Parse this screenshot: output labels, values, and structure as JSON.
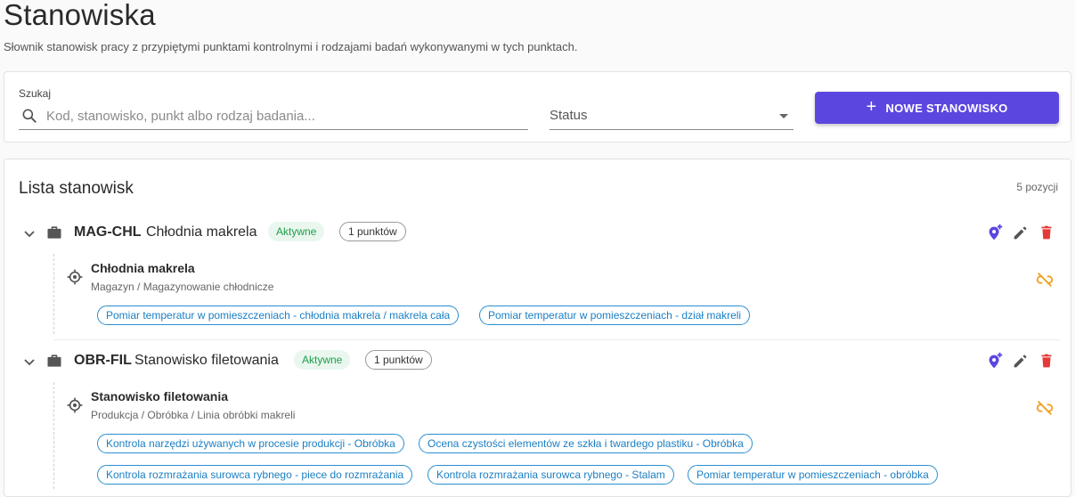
{
  "page": {
    "title": "Stanowiska",
    "subtitle": "Słownik stanowisk pracy z przypiętymi punktami kontrolnymi i rodzajami badań wykonywanymi w tych punktach."
  },
  "search": {
    "label": "Szukaj",
    "placeholder": "Kod, stanowisko, punkt albo rodzaj badania...",
    "value": "",
    "status_label": "Status",
    "new_button_label": "NOWE STANOWISKO"
  },
  "colors": {
    "accent": "#5b47e0",
    "active": "#1e9e4a",
    "delete": "#e53935",
    "unlink": "#f0a020",
    "chip": "#1a7fc4"
  },
  "list": {
    "title": "Lista stanowisk",
    "count": "5 pozycji",
    "stations": [
      {
        "code": "MAG-CHL",
        "name": "Chłodnia makrela",
        "status": "Aktywne",
        "points_label": "1 punktów",
        "points": [
          {
            "name": "Chłodnia makrela",
            "path": "Magazyn / Magazynowanie chłodnicze",
            "tests": [
              "Pomiar temperatur w pomieszczeniach - chłodnia makrela / makrela cała",
              "Pomiar temperatur w pomieszczeniach - dział makreli"
            ]
          }
        ]
      },
      {
        "code": "OBR-FIL",
        "name": "Stanowisko filetowania",
        "status": "Aktywne",
        "points_label": "1 punktów",
        "points": [
          {
            "name": "Stanowisko filetowania",
            "path": "Produkcja / Obróbka / Linia obróbki makreli",
            "tests": [
              "Kontrola narzędzi używanych w procesie produkcji - Obróbka",
              "Ocena czystości elementów ze szkła i twardego plastiku - Obróbka",
              "Kontrola rozmrażania surowca rybnego - piece do rozmrażania",
              "Kontrola rozmrażania surowca rybnego - Stalam",
              "Pomiar temperatur w pomieszczeniach - obróbka"
            ]
          }
        ]
      }
    ]
  }
}
